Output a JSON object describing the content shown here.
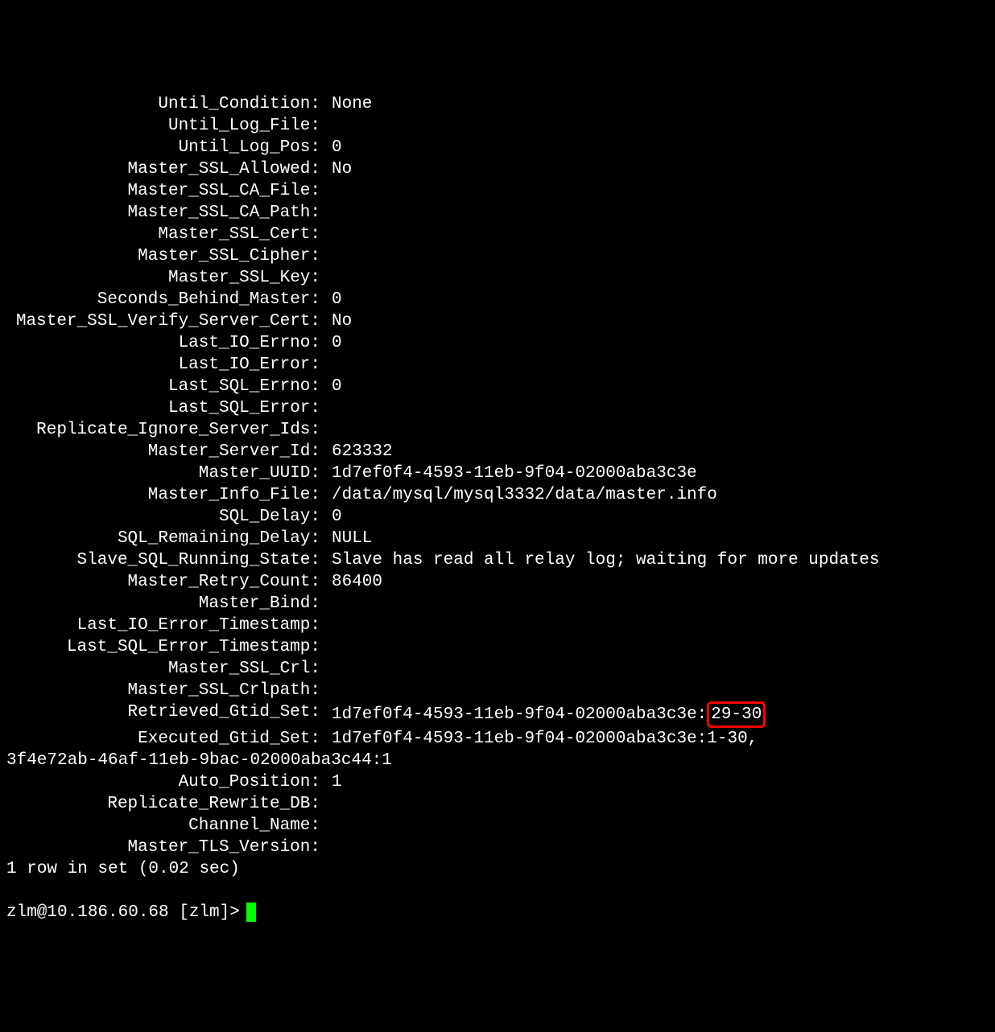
{
  "rows": [
    {
      "label": "Until_Condition:",
      "value": "None"
    },
    {
      "label": "Until_Log_File:",
      "value": ""
    },
    {
      "label": "Until_Log_Pos:",
      "value": "0"
    },
    {
      "label": "Master_SSL_Allowed:",
      "value": "No"
    },
    {
      "label": "Master_SSL_CA_File:",
      "value": ""
    },
    {
      "label": "Master_SSL_CA_Path:",
      "value": ""
    },
    {
      "label": "Master_SSL_Cert:",
      "value": ""
    },
    {
      "label": "Master_SSL_Cipher:",
      "value": ""
    },
    {
      "label": "Master_SSL_Key:",
      "value": ""
    },
    {
      "label": "Seconds_Behind_Master:",
      "value": "0"
    },
    {
      "label": "Master_SSL_Verify_Server_Cert:",
      "value": "No"
    },
    {
      "label": "Last_IO_Errno:",
      "value": "0"
    },
    {
      "label": "Last_IO_Error:",
      "value": ""
    },
    {
      "label": "Last_SQL_Errno:",
      "value": "0"
    },
    {
      "label": "Last_SQL_Error:",
      "value": ""
    },
    {
      "label": "Replicate_Ignore_Server_Ids:",
      "value": ""
    },
    {
      "label": "Master_Server_Id:",
      "value": "623332"
    },
    {
      "label": "Master_UUID:",
      "value": "1d7ef0f4-4593-11eb-9f04-02000aba3c3e"
    },
    {
      "label": "Master_Info_File:",
      "value": "/data/mysql/mysql3332/data/master.info"
    },
    {
      "label": "SQL_Delay:",
      "value": "0"
    },
    {
      "label": "SQL_Remaining_Delay:",
      "value": "NULL"
    },
    {
      "label": "Slave_SQL_Running_State:",
      "value": "Slave has read all relay log; waiting for more updates"
    },
    {
      "label": "Master_Retry_Count:",
      "value": "86400"
    },
    {
      "label": "Master_Bind:",
      "value": ""
    },
    {
      "label": "Last_IO_Error_Timestamp:",
      "value": ""
    },
    {
      "label": "Last_SQL_Error_Timestamp:",
      "value": ""
    },
    {
      "label": "Master_SSL_Crl:",
      "value": ""
    },
    {
      "label": "Master_SSL_Crlpath:",
      "value": ""
    }
  ],
  "retrieved_gtid": {
    "label": "Retrieved_Gtid_Set:",
    "prefix": "1d7ef0f4-4593-11eb-9f04-02000aba3c3e:",
    "highlighted": "29-30"
  },
  "executed_gtid": {
    "label": "Executed_Gtid_Set:",
    "line1": "1d7ef0f4-4593-11eb-9f04-02000aba3c3e:1-30,",
    "line2": "3f4e72ab-46af-11eb-9bac-02000aba3c44:1"
  },
  "tail_rows": [
    {
      "label": "Auto_Position:",
      "value": "1"
    },
    {
      "label": "Replicate_Rewrite_DB:",
      "value": ""
    },
    {
      "label": "Channel_Name:",
      "value": ""
    },
    {
      "label": "Master_TLS_Version:",
      "value": ""
    }
  ],
  "summary": "1 row in set (0.02 sec)",
  "prompt": "zlm@10.186.60.68 [zlm]>"
}
